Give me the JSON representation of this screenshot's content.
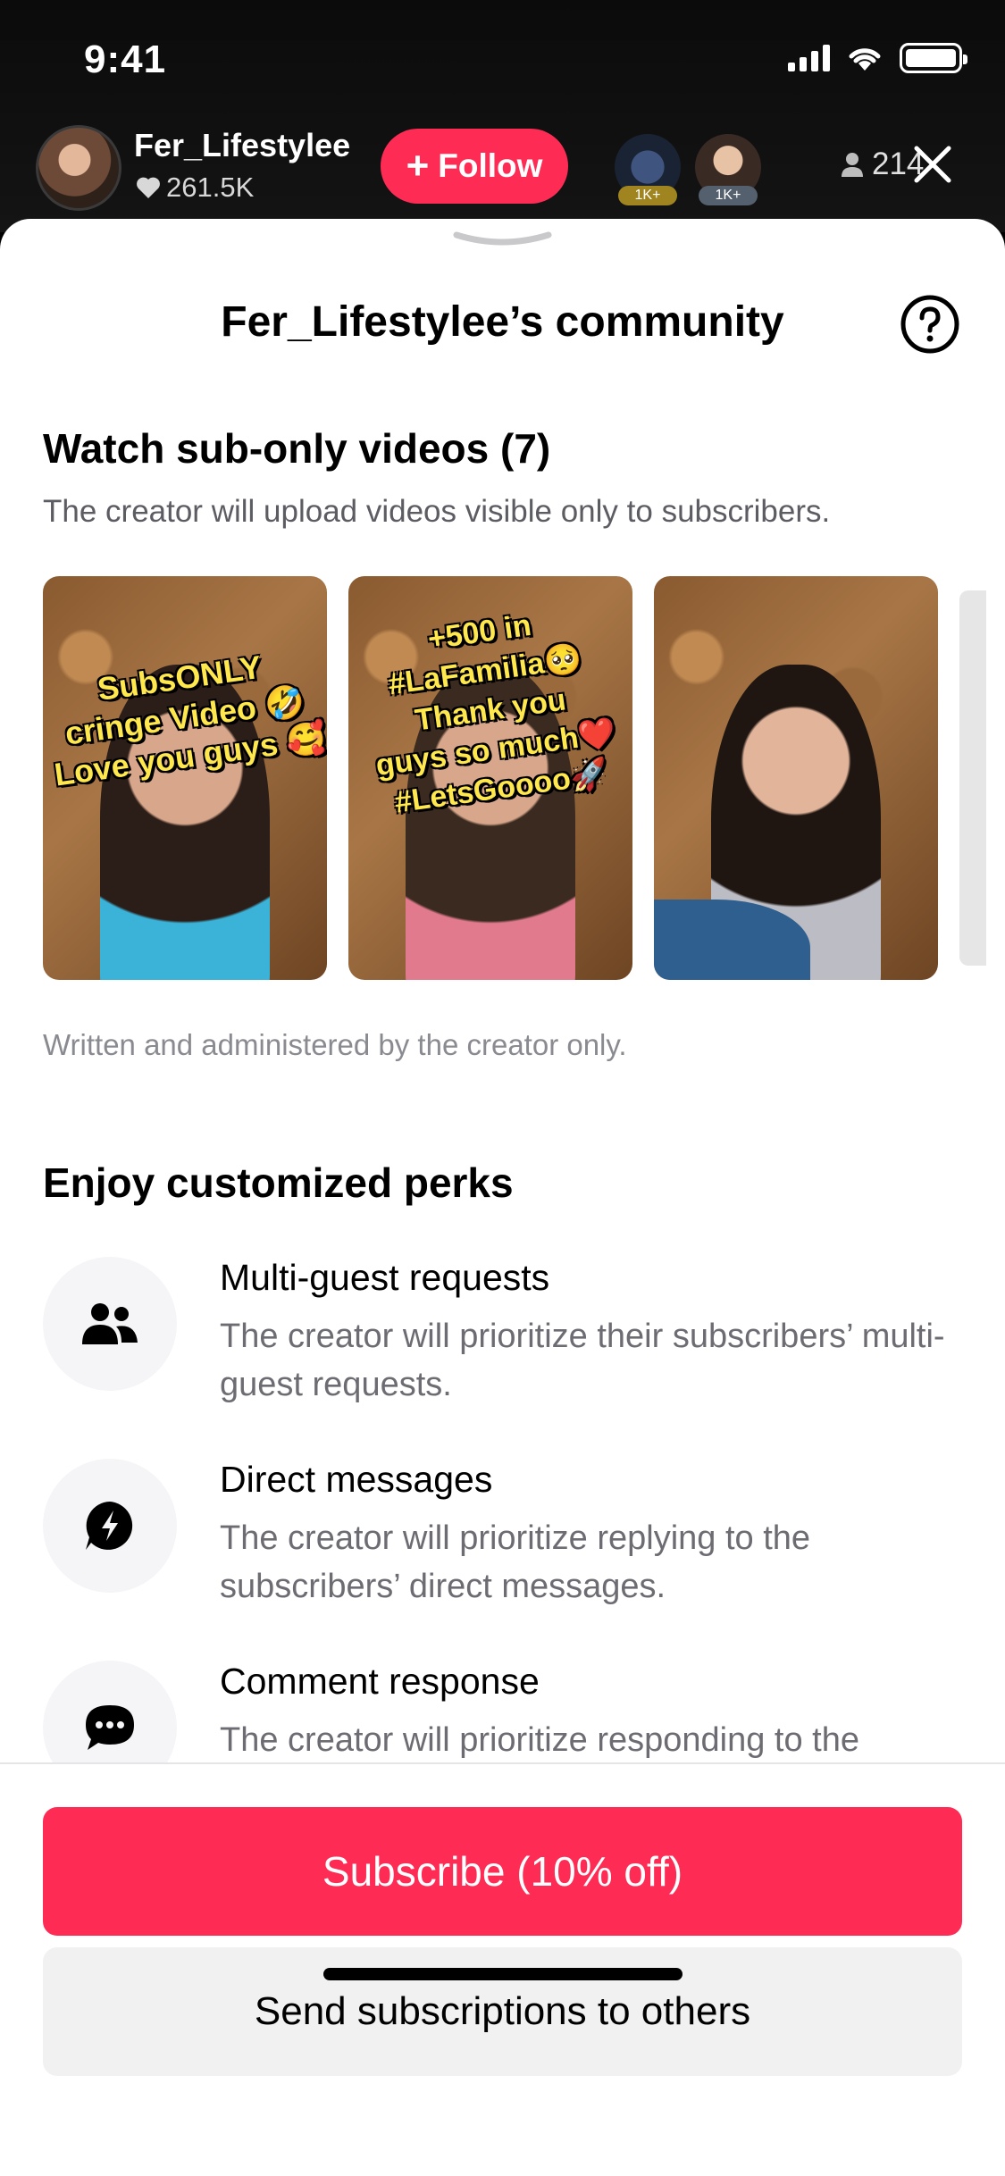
{
  "status_bar": {
    "time": "9:41"
  },
  "live_header": {
    "host_name": "Fer_Lifestylee",
    "host_likes": "261.5K",
    "follow_label": "Follow",
    "gift_badges": [
      {
        "label": "1K+"
      },
      {
        "label": "1K+"
      }
    ],
    "viewer_count": "214"
  },
  "sheet": {
    "title": "Fer_Lifestylee’s community",
    "videos_section": {
      "title": "Watch sub-only videos (7)",
      "subtitle": "The creator will upload videos visible only to subscribers.",
      "thumbnails": [
        {
          "caption_lines": [
            "SubsONLY",
            "cringe Video 🤣",
            "Love you guys 🥰"
          ]
        },
        {
          "caption_lines": [
            "+500 in",
            "#LaFamilia🥺",
            "Thank you",
            "guys so much❤️",
            "#LetsGoooo🚀"
          ]
        },
        {
          "caption_lines": []
        }
      ],
      "footnote": "Written and administered by the creator only."
    },
    "perks_section": {
      "title": "Enjoy customized perks",
      "items": [
        {
          "icon": "people-icon",
          "title": "Multi-guest requests",
          "desc": "The creator will prioritize their subscribers’ multi-guest requests."
        },
        {
          "icon": "lightning-message-icon",
          "title": "Direct messages",
          "desc": "The creator will prioritize replying to the subscribers’ direct messages."
        },
        {
          "icon": "comment-dots-icon",
          "title": "Comment response",
          "desc": "The creator will prioritize responding to the"
        }
      ]
    }
  },
  "actions": {
    "subscribe_label": "Subscribe (10% off)",
    "send_label": "Send subscriptions to others"
  },
  "colors": {
    "accent": "#fe2c55",
    "secondary_button": "#f1f1f2"
  }
}
